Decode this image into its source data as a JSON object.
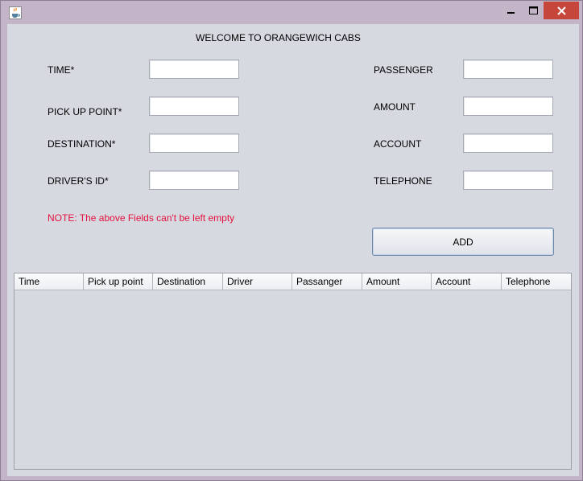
{
  "window": {
    "icon": "java-cup-icon",
    "controls": [
      "minimize-icon",
      "maximize-icon",
      "close-icon"
    ],
    "close_color": "#c7463c"
  },
  "form": {
    "title": "WELCOME TO ORANGEWICH CABS",
    "left_fields": [
      {
        "label": "TIME*",
        "value": ""
      },
      {
        "label": "PICK UP POINT*",
        "value": ""
      },
      {
        "label": "DESTINATION*",
        "value": ""
      },
      {
        "label": "DRIVER'S ID*",
        "value": ""
      }
    ],
    "right_fields": [
      {
        "label": "PASSENGER",
        "value": ""
      },
      {
        "label": "AMOUNT",
        "value": ""
      },
      {
        "label": "ACCOUNT",
        "value": ""
      },
      {
        "label": "TELEPHONE",
        "value": ""
      }
    ],
    "note": "NOTE: The above Fields can't be left empty",
    "note_color": "#e5103d",
    "add_label": "ADD"
  },
  "table": {
    "columns": [
      "Time",
      "Pick up point",
      "Destination",
      "Driver",
      "Passanger",
      "Amount",
      "Account",
      "Telephone"
    ],
    "rows": []
  }
}
